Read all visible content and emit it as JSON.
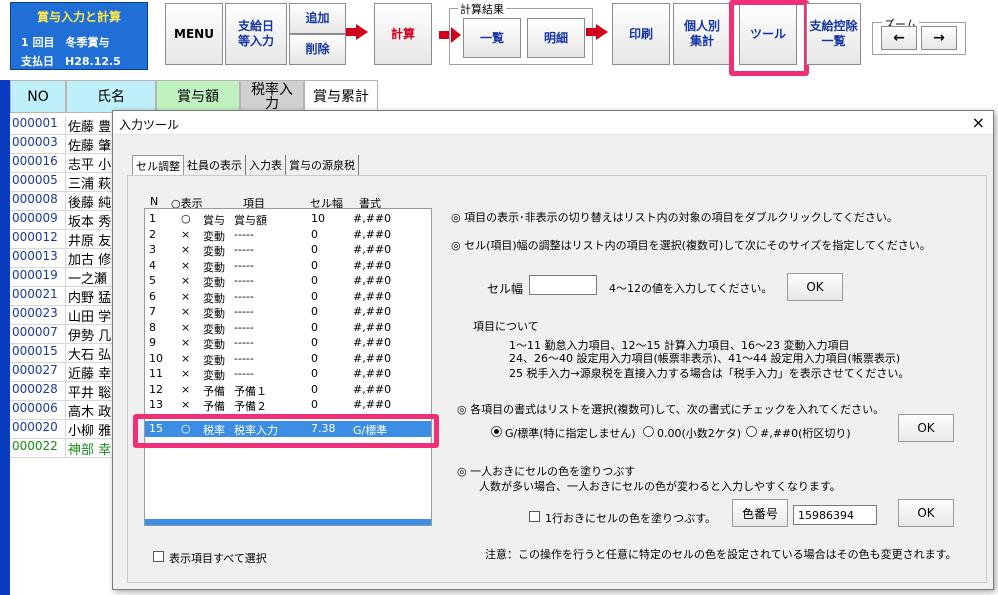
{
  "header": {
    "title": "賞与入力と計算",
    "round": "1 回目　冬季賞与",
    "paydate": "支払日　H28.12.5"
  },
  "toolbar": {
    "menu": "MENU",
    "payday_input": "支給日\n等入力",
    "add": "追加",
    "delete": "削除",
    "calc": "計算",
    "calc_result_label": "計算結果",
    "list": "一覧",
    "detail": "明細",
    "print": "印刷",
    "individual_total": "個人別\n集計",
    "tool": "ツール",
    "deduction_list": "支給控除\n一覧",
    "zoom_label": "ズーム",
    "zoom_left": "←",
    "zoom_right": "→"
  },
  "sheet": {
    "columns": [
      "NO",
      "氏名",
      "賞与額",
      "税率入力",
      "賞与累計"
    ],
    "rows": [
      {
        "no": "000001",
        "name": "佐藤 豊"
      },
      {
        "no": "000003",
        "name": "佐藤 肇"
      },
      {
        "no": "000016",
        "name": "志平 小"
      },
      {
        "no": "000005",
        "name": "三浦 萩"
      },
      {
        "no": "000008",
        "name": "後藤 純"
      },
      {
        "no": "000009",
        "name": "坂本 秀"
      },
      {
        "no": "000012",
        "name": "井原 友"
      },
      {
        "no": "000013",
        "name": "加古 修"
      },
      {
        "no": "000019",
        "name": "一之瀬"
      },
      {
        "no": "000021",
        "name": "内野 猛"
      },
      {
        "no": "000023",
        "name": "山田 学"
      },
      {
        "no": "000007",
        "name": "伊勢 几"
      },
      {
        "no": "000015",
        "name": "大石 弘"
      },
      {
        "no": "000027",
        "name": "近藤 幸"
      },
      {
        "no": "000028",
        "name": "平井 聡"
      },
      {
        "no": "000006",
        "name": "高木 政"
      },
      {
        "no": "000020",
        "name": "小柳 雅"
      },
      {
        "no": "000022",
        "name": "神部 幸"
      }
    ]
  },
  "dialog": {
    "title": "入力ツール",
    "close": "×",
    "tabs": [
      "セル調整",
      "社員の表示",
      "入力表",
      "賞与の源泉税"
    ],
    "list_headers": {
      "n": "N",
      "show": "○表示",
      "item": "項目",
      "width": "セル幅",
      "format": "書式"
    },
    "list_rows": [
      {
        "n": "1",
        "show": "○",
        "type": "賞与",
        "item": "賞与額",
        "width": "10",
        "fmt": "#,##0"
      },
      {
        "n": "2",
        "show": "×",
        "type": "変動",
        "item": "-----",
        "width": "0",
        "fmt": "#,##0"
      },
      {
        "n": "3",
        "show": "×",
        "type": "変動",
        "item": "-----",
        "width": "0",
        "fmt": "#,##0"
      },
      {
        "n": "4",
        "show": "×",
        "type": "変動",
        "item": "-----",
        "width": "0",
        "fmt": "#,##0"
      },
      {
        "n": "5",
        "show": "×",
        "type": "変動",
        "item": "-----",
        "width": "0",
        "fmt": "#,##0"
      },
      {
        "n": "6",
        "show": "×",
        "type": "変動",
        "item": "-----",
        "width": "0",
        "fmt": "#,##0"
      },
      {
        "n": "7",
        "show": "×",
        "type": "変動",
        "item": "-----",
        "width": "0",
        "fmt": "#,##0"
      },
      {
        "n": "8",
        "show": "×",
        "type": "変動",
        "item": "-----",
        "width": "0",
        "fmt": "#,##0"
      },
      {
        "n": "9",
        "show": "×",
        "type": "変動",
        "item": "-----",
        "width": "0",
        "fmt": "#,##0"
      },
      {
        "n": "10",
        "show": "×",
        "type": "変動",
        "item": "-----",
        "width": "0",
        "fmt": "#,##0"
      },
      {
        "n": "11",
        "show": "×",
        "type": "変動",
        "item": "-----",
        "width": "0",
        "fmt": "#,##0"
      },
      {
        "n": "12",
        "show": "×",
        "type": "予備",
        "item": "予備１",
        "width": "0",
        "fmt": "#,##0"
      },
      {
        "n": "13",
        "show": "×",
        "type": "予備",
        "item": "予備２",
        "width": "0",
        "fmt": "#,##0"
      }
    ],
    "selected_row": {
      "n": "15",
      "show": "○",
      "type": "税率",
      "item": "税率入力",
      "width": "7.38",
      "fmt": "G/標準"
    },
    "select_all_label": "表示項目すべて選択",
    "info1": "◎ 項目の表示･非表示の切り替えはリスト内の対象の項目をダブルクリックしてください。",
    "info2": "◎ セル(項目)幅の調整はリスト内の項目を選択(複数可)して次にそのサイズを指定してください。",
    "cell_width_label": "セル幅",
    "cell_width_value": "",
    "cell_width_hint": "4～12の値を入力してください。",
    "ok": "OK",
    "about_label": "項目について",
    "about_lines": [
      "1～11 勤怠入力項目、12～15 計算入力項目、16～23 変動入力項目",
      "24、26～40 設定用入力項目(帳票非表示)、41～44 設定用入力項目(帳票表示)",
      "25 税手入力→源泉税を直接入力する場合は「税手入力」を表示させてください。"
    ],
    "format_info": "◎ 各項目の書式はリストを選択(複数可)して、次の書式にチェックを入れてください。",
    "format_options": [
      "G/標準(特に指定しません)",
      "0.00(小数2ケタ)",
      "#,##0(桁区切り)"
    ],
    "color_info": "◎ 一人おきにセルの色を塗りつぶす",
    "color_info2": "人数が多い場合、一人おきにセルの色が変わると入力しやすくなります。",
    "color_check_label": "1行おきにセルの色を塗りつぶす。",
    "color_number_button": "色番号",
    "color_number_value": "15986394",
    "note": "注意：この操作を行うと任意に特定のセルの色を設定されている場合はその色も変更されます。"
  }
}
